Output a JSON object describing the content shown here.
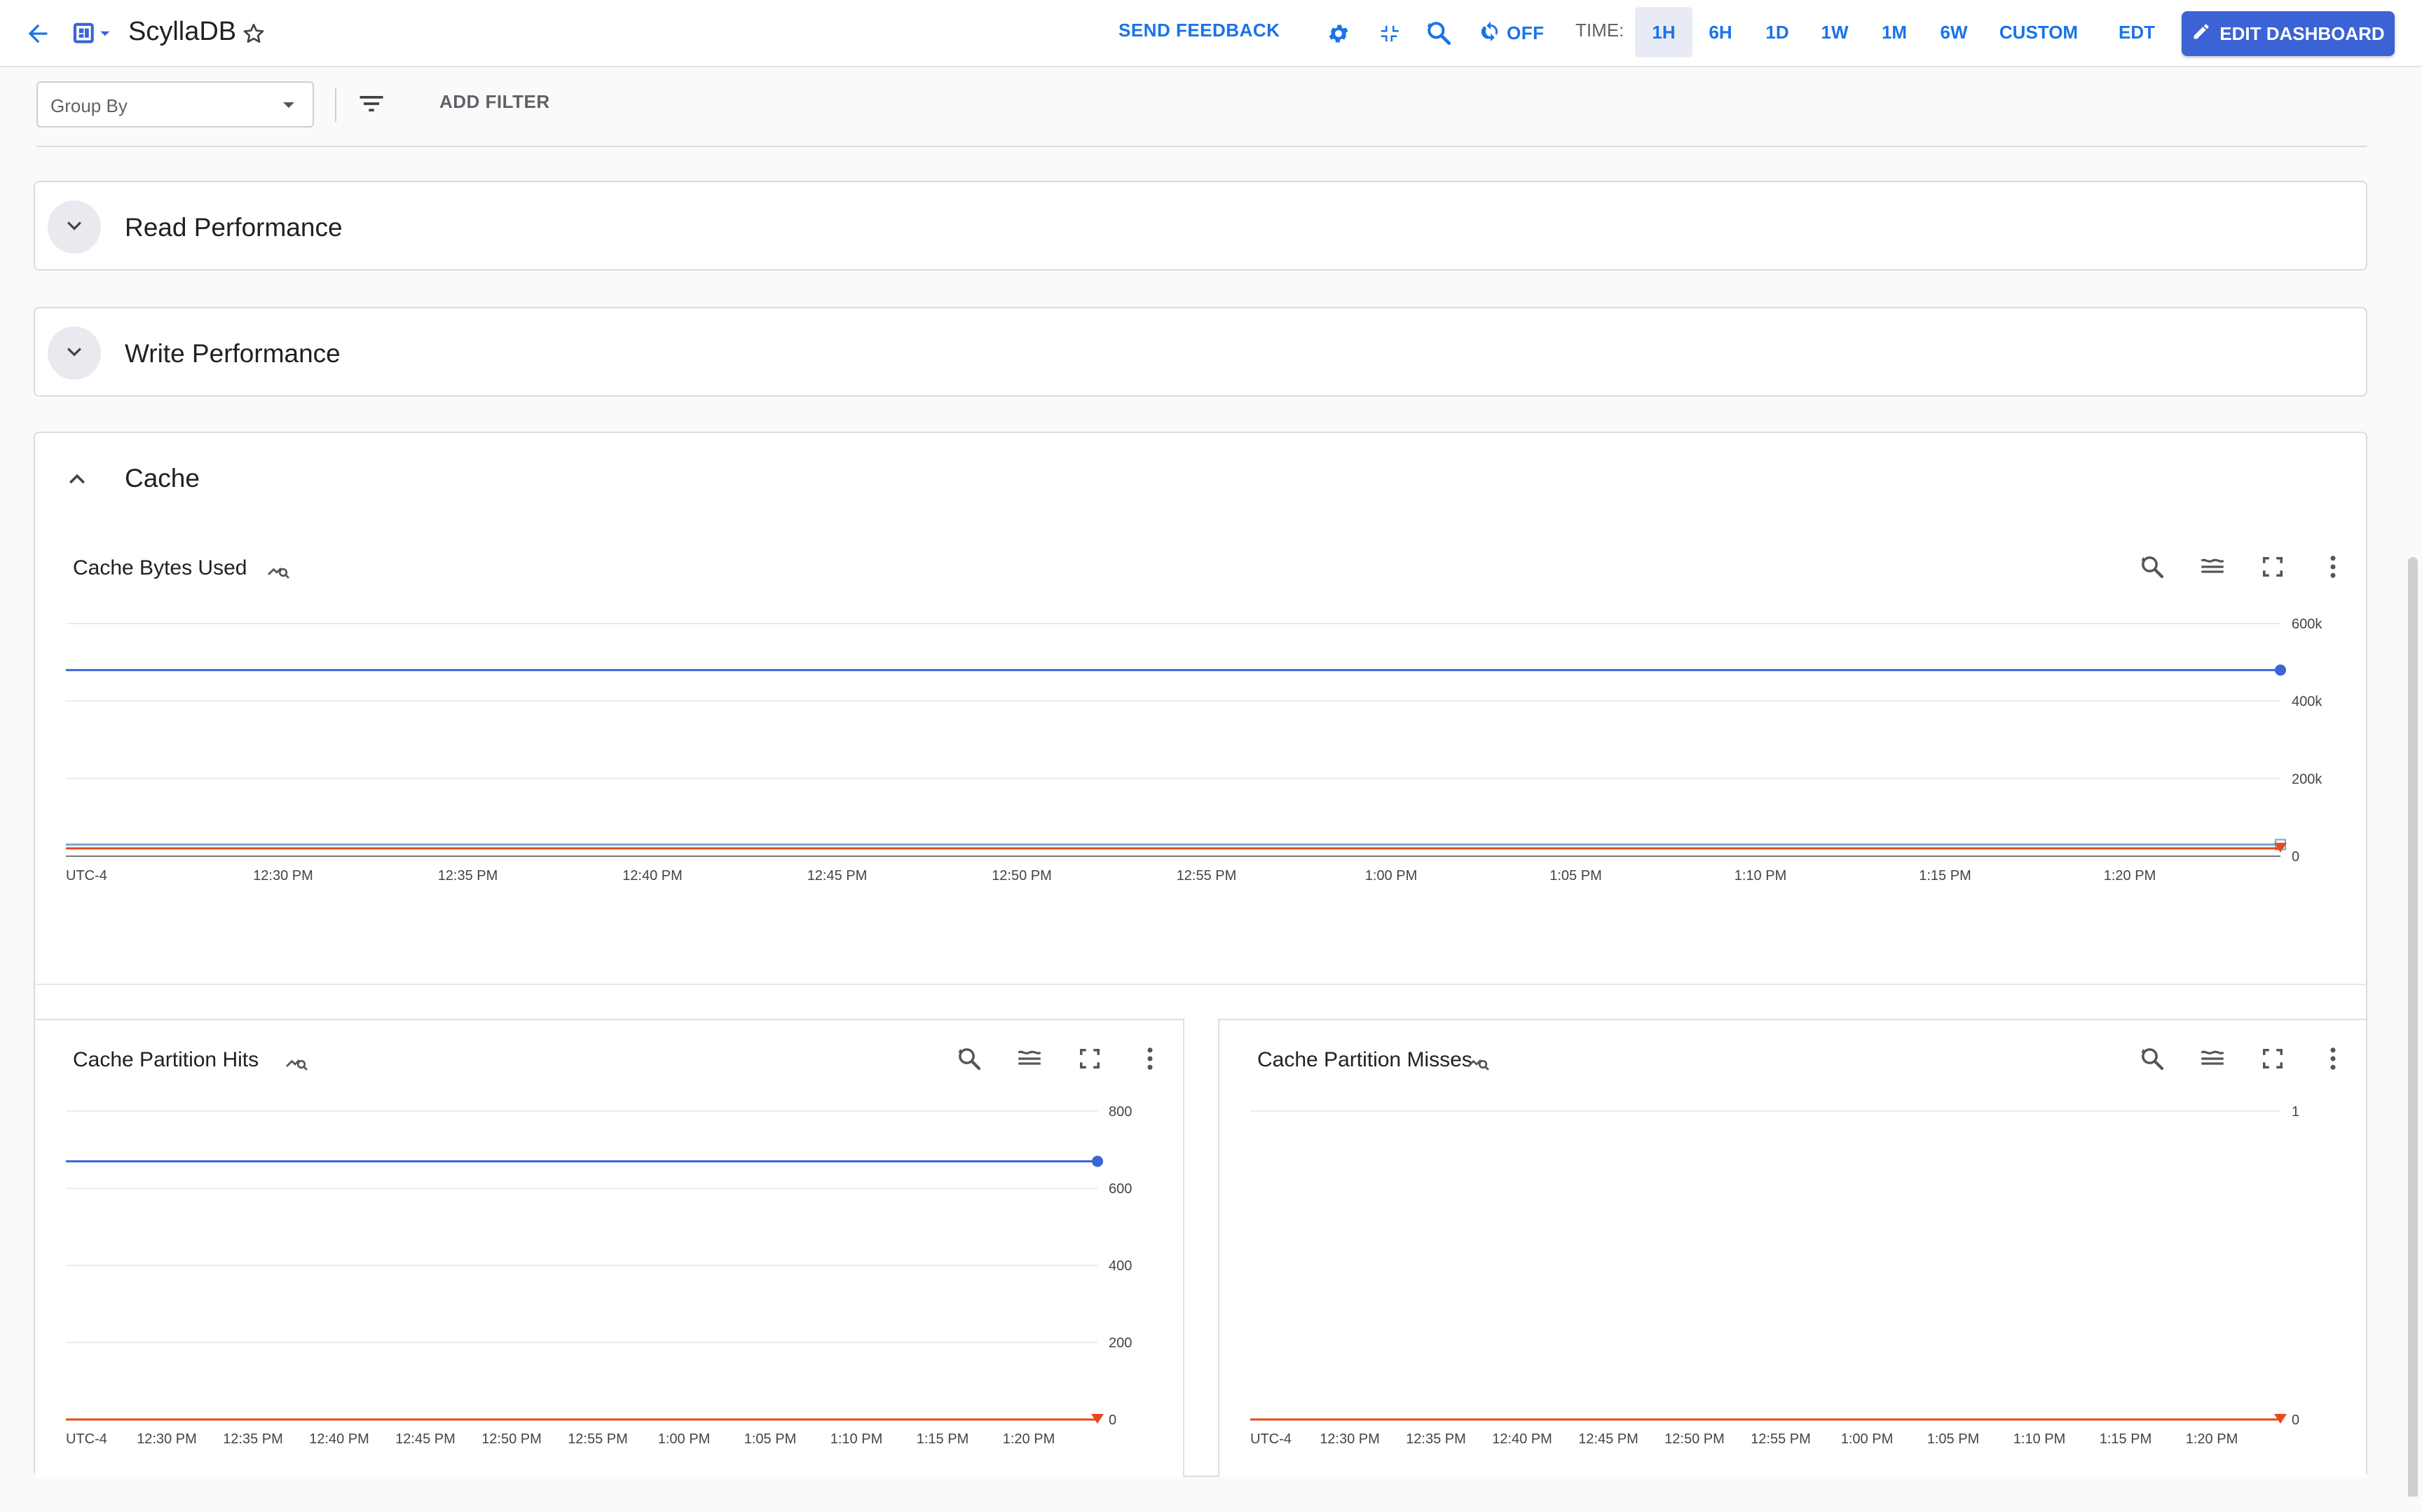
{
  "topbar": {
    "title": "ScyllaDB",
    "send_feedback": "SEND FEEDBACK",
    "refresh_label": "OFF",
    "time_label": "TIME:",
    "time_options": [
      "1H",
      "6H",
      "1D",
      "1W",
      "1M",
      "6W",
      "CUSTOM"
    ],
    "selected_time": "1H",
    "timezone": "EDT",
    "edit_button": "EDIT DASHBOARD",
    "accent_color": "#1a73e8",
    "edit_button_color": "#3b63d6"
  },
  "filters": {
    "group_by_placeholder": "Group By",
    "add_filter": "ADD FILTER"
  },
  "sections": [
    {
      "title": "Read Performance",
      "expanded": false
    },
    {
      "title": "Write Performance",
      "expanded": false
    },
    {
      "title": "Cache",
      "expanded": true
    }
  ],
  "icons": [
    "back-arrow-icon",
    "dashboard-icon",
    "star-icon",
    "settings-icon",
    "collapse-icon",
    "zoom-reset-icon",
    "refresh-icon",
    "edit-icon",
    "filter-icon",
    "chevron-down-icon",
    "chevron-up-icon",
    "query-inspect-icon",
    "legend-icon",
    "fullscreen-icon",
    "more-vert-icon"
  ],
  "chart_data": [
    {
      "type": "line",
      "title": "Cache Bytes Used",
      "timezone_label": "UTC-4",
      "x_ticks": [
        "12:30 PM",
        "12:35 PM",
        "12:40 PM",
        "12:45 PM",
        "12:50 PM",
        "12:55 PM",
        "1:00 PM",
        "1:05 PM",
        "1:10 PM",
        "1:15 PM",
        "1:20 PM"
      ],
      "y_ticks": [
        "600k",
        "400k",
        "200k",
        "0"
      ],
      "ylim": [
        0,
        600000
      ],
      "series": [
        {
          "values": [
            480000,
            480000
          ],
          "color": "#3c66d8"
        },
        {
          "values": [
            30000,
            30000
          ],
          "color": "#6fa8dc"
        },
        {
          "values": [
            20000,
            20000
          ],
          "color": "#e64a19"
        }
      ]
    },
    {
      "type": "line",
      "title": "Cache Partition Hits",
      "timezone_label": "UTC-4",
      "x_ticks": [
        "12:30 PM",
        "12:35 PM",
        "12:40 PM",
        "12:45 PM",
        "12:50 PM",
        "12:55 PM",
        "1:00 PM",
        "1:05 PM",
        "1:10 PM",
        "1:15 PM",
        "1:20 PM"
      ],
      "y_ticks": [
        "800",
        "600",
        "400",
        "200",
        "0"
      ],
      "ylim": [
        0,
        800
      ],
      "series": [
        {
          "values": [
            670,
            670
          ],
          "color": "#3c66d8"
        },
        {
          "values": [
            0,
            0
          ],
          "color": "#e64a19"
        }
      ]
    },
    {
      "type": "line",
      "title": "Cache Partition Misses",
      "timezone_label": "UTC-4",
      "x_ticks": [
        "12:30 PM",
        "12:35 PM",
        "12:40 PM",
        "12:45 PM",
        "12:50 PM",
        "12:55 PM",
        "1:00 PM",
        "1:05 PM",
        "1:10 PM",
        "1:15 PM",
        "1:20 PM"
      ],
      "y_ticks": [
        "1",
        "0"
      ],
      "ylim": [
        0,
        1
      ],
      "series": [
        {
          "values": [
            0,
            0
          ],
          "color": "#e64a19"
        }
      ]
    }
  ]
}
